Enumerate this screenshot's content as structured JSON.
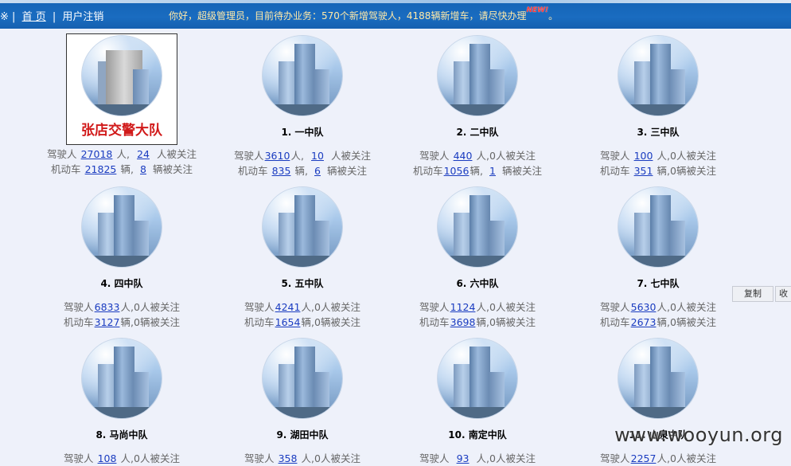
{
  "nav": {
    "bullet": "※",
    "sep1": "|",
    "home": "首 页",
    "sep2": "|",
    "logout": "用户注销"
  },
  "message": {
    "text": "你好，超级管理员，目前待办业务：570个新增驾驶人，4188辆新增车，请尽快办理",
    "badge": "NEW!",
    "tail": "。"
  },
  "units": [
    {
      "name": "张店交警大队",
      "hq": true,
      "drivers": "27018",
      "drivers_followed": "24",
      "vehicles": "21825",
      "vehicles_followed": "8"
    },
    {
      "name": "1. 一中队",
      "drivers": "3610",
      "drivers_followed": "10",
      "vehicles": "835",
      "vehicles_followed": "6"
    },
    {
      "name": "2. 二中队",
      "drivers": "440",
      "drivers_followed_text": "0人被关注",
      "vehicles": "1056",
      "vehicles_followed": "1"
    },
    {
      "name": "3. 三中队",
      "drivers": "100",
      "drivers_followed_text": "0人被关注",
      "vehicles": "351",
      "vehicles_followed_text": "0辆被关注"
    },
    {
      "name": "4. 四中队",
      "drivers": "6833",
      "drivers_followed_text": "0人被关注",
      "vehicles": "3127",
      "vehicles_followed_text": "0辆被关注"
    },
    {
      "name": "5. 五中队",
      "drivers": "4241",
      "drivers_followed_text": "0人被关注",
      "vehicles": "1654",
      "vehicles_followed_text": "0辆被关注"
    },
    {
      "name": "6. 六中队",
      "drivers": "1124",
      "drivers_followed_text": "0人被关注",
      "vehicles": "3698",
      "vehicles_followed_text": "0辆被关注"
    },
    {
      "name": "7. 七中队",
      "drivers": "5630",
      "drivers_followed_text": "0人被关注",
      "vehicles": "2673",
      "vehicles_followed_text": "0辆被关注"
    },
    {
      "name": "8. 马尚中队",
      "drivers": "108",
      "drivers_followed_text": "0人被关注"
    },
    {
      "name": "9. 湖田中队",
      "drivers": "358",
      "drivers_followed_text": "0人被关注"
    },
    {
      "name": "10. 南定中队",
      "drivers": "93",
      "drivers_followed_text": "0人被关注"
    },
    {
      "name": "11. 山泉中队",
      "drivers": "2257",
      "drivers_followed_text": "0人被关注"
    }
  ],
  "labels": {
    "driver": "驾驶人",
    "person_unit": "人,",
    "followed_person": "人被关注",
    "vehicle": "机动车",
    "vehicle_unit": "辆,",
    "followed_vehicle": "辆被关注"
  },
  "side_buttons": {
    "copy": "复制",
    "collect": "收"
  },
  "watermark": "www.wooyun.org"
}
